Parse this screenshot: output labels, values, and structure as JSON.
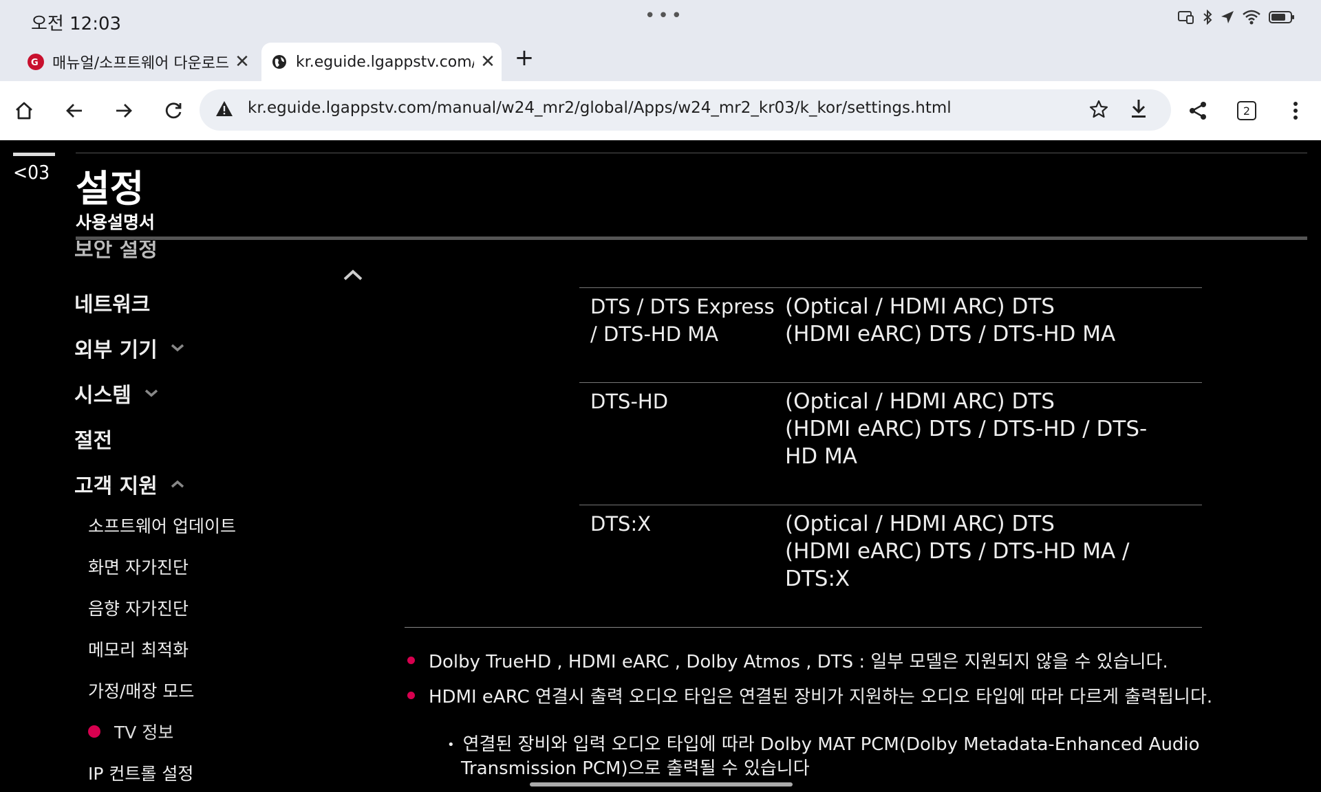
{
  "status_bar": {
    "time": "오전 12:03",
    "dots": "•••"
  },
  "tabs": [
    {
      "title": "매뉴얼/소프트웨어 다운로드 |",
      "favicon": "lg-logo-icon",
      "active": false
    },
    {
      "title": "kr.eguide.lgappstv.com/mar",
      "favicon": "globe-icon",
      "active": true
    }
  ],
  "toolbar": {
    "url": "kr.eguide.lgappstv.com/manual/w24_mr2/global/Apps/w24_mr2_kr03/k_kor/settings.html",
    "tab_count": "2"
  },
  "page": {
    "chapter": "<03",
    "title": "설정",
    "subtitle": "사용설명서"
  },
  "sidebar": {
    "partial_item": "보안 설정",
    "main_items": [
      {
        "label": "네트워크",
        "chevron": "none"
      },
      {
        "label": "외부 기기",
        "chevron": "down"
      },
      {
        "label": "시스템",
        "chevron": "down"
      },
      {
        "label": "절전",
        "chevron": "none"
      },
      {
        "label": "고객 지원",
        "chevron": "up"
      }
    ],
    "sub_items": [
      {
        "label": "소프트웨어 업데이트",
        "active": false
      },
      {
        "label": "화면 자가진단",
        "active": false
      },
      {
        "label": "음향 자가진단",
        "active": false
      },
      {
        "label": "메모리 최적화",
        "active": false
      },
      {
        "label": "가정/매장 모드",
        "active": false
      },
      {
        "label": "TV 정보",
        "active": true
      },
      {
        "label": "IP 컨트롤 설정",
        "active": false
      }
    ]
  },
  "table": {
    "rows": [
      {
        "format": [
          "DTS / DTS Express",
          "/ DTS-HD MA"
        ],
        "output": [
          "(Optical / HDMI ARC) DTS",
          "(HDMI eARC) DTS / DTS-HD MA"
        ]
      },
      {
        "format": [
          "DTS-HD"
        ],
        "output": [
          "(Optical / HDMI ARC) DTS",
          "(HDMI eARC) DTS / DTS-HD / DTS-",
          "HD MA"
        ]
      },
      {
        "format": [
          "DTS:X"
        ],
        "output": [
          "(Optical / HDMI ARC) DTS",
          "(HDMI eARC) DTS / DTS-HD MA /",
          "DTS:X"
        ]
      }
    ]
  },
  "notes": [
    "Dolby TrueHD , HDMI eARC , Dolby Atmos , DTS : 일부 모델은 지원되지 않을 수 있습니다.",
    "HDMI eARC 연결시 출력 오디오 타입은 연결된 장비가 지원하는 오디오 타입에 따라 다르게 출력됩니다."
  ],
  "subnote": [
    "연결된 장비와 입력 오디오 타입에 따라 Dolby MAT PCM(Dolby Metadata-Enhanced Audio",
    "Transmission PCM)으로 출력될 수 있습니다"
  ],
  "colors": {
    "accent": "#d7004f",
    "chrome_bg": "#e6e9f0",
    "page_bg": "#000000"
  }
}
